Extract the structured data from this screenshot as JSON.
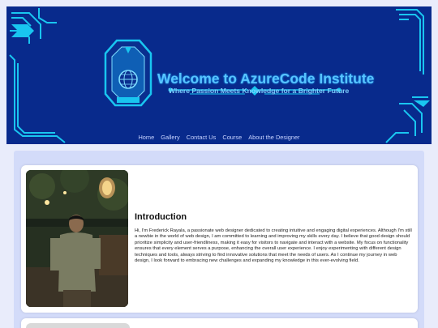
{
  "header": {
    "title": "Welcome to AzureCode Institute",
    "tagline": "Where Passion Meets Knowledge for a Brighter Future",
    "logo_icon": "globe-shield-icon",
    "colors": {
      "background": "#082a8c",
      "accent": "#19c6f0",
      "title": "#58c4ff"
    }
  },
  "nav": {
    "items": [
      {
        "label": "Home"
      },
      {
        "label": "Gallery"
      },
      {
        "label": "Contact Us"
      },
      {
        "label": "Course"
      },
      {
        "label": "About the Designer"
      }
    ]
  },
  "intro": {
    "title": "Introduction",
    "body": "Hi, I'm Frederick Rayala, a passionate web designer dedicated to creating intuitive and engaging digital experiences. Although I'm still a newbie in the world of web design, I am committed to learning and improving my skills every day. I believe that good design should prioritize simplicity and user-friendliness, making it easy for visitors to navigate and interact with a website. My focus on functionality ensures that every element serves a purpose, enhancing the overall user experience. I enjoy experimenting with different design techniques and tools, always striving to find innovative solutions that meet the needs of users. As I continue my journey in web design, I look forward to embracing new challenges and expanding my knowledge in this ever-evolving field."
  }
}
